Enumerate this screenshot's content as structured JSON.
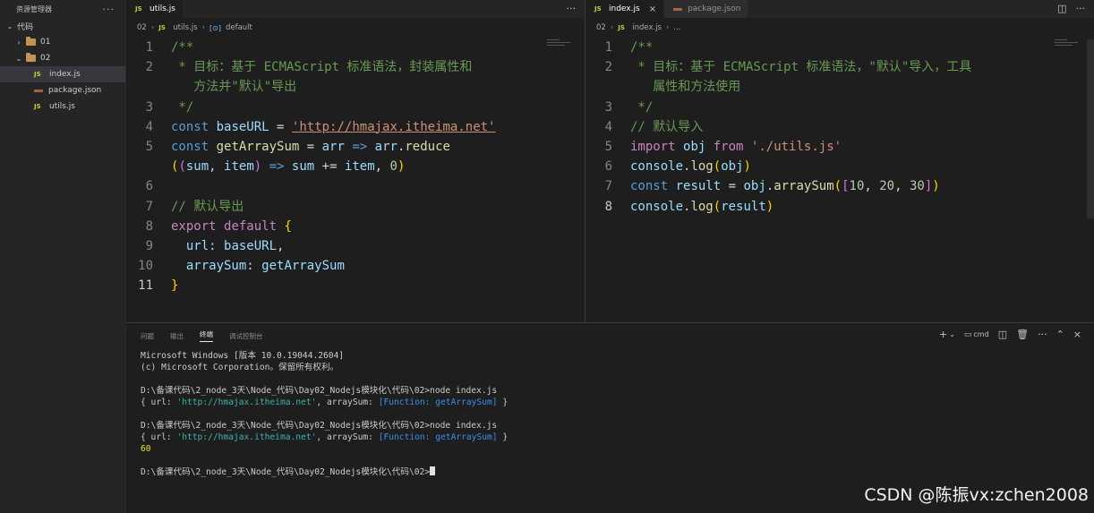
{
  "explorer": {
    "title": "资源管理器",
    "more": "···",
    "root": "代码",
    "items": [
      {
        "label": "01"
      },
      {
        "label": "02"
      },
      {
        "label": "index.js"
      },
      {
        "label": "package.json"
      },
      {
        "label": "utils.js"
      }
    ]
  },
  "editor_left": {
    "tab_label": "utils.js",
    "tab_badge": "JS",
    "more": "···",
    "breadcrumb": {
      "folder": "02",
      "file": "utils.js",
      "symbol": "default",
      "symbol_icon": "[⊙]"
    },
    "line_numbers": [
      "1",
      "2",
      "",
      "3",
      "4",
      "5",
      "",
      "6",
      "7",
      "8",
      "9",
      "10",
      "11"
    ]
  },
  "editor_right": {
    "tabs": [
      {
        "label": "index.js",
        "badge": "JS",
        "close": "×"
      },
      {
        "label": "package.json"
      }
    ],
    "breadcrumb": {
      "folder": "02",
      "file": "index.js",
      "rest": "..."
    },
    "line_numbers": [
      "1",
      "2",
      "",
      "3",
      "4",
      "5",
      "6",
      "7",
      "8"
    ]
  },
  "panel": {
    "tabs": [
      "问题",
      "输出",
      "终端",
      "调试控制台"
    ],
    "active_tab": "终端",
    "actions": {
      "add": "+",
      "chevron": "⌄",
      "shell": "cmd",
      "more": "···",
      "up": "⌃",
      "close": "×"
    },
    "terminal": {
      "line1": "Microsoft Windows [版本 10.0.19044.2604]",
      "line2": "(c) Microsoft Corporation。保留所有权利。",
      "prompt_cmd": "D:\\备课代码\\2_node_3天\\Node_代码\\Day02_Nodejs模块化\\代码\\02>node index.js",
      "out_prefix": "{ url: ",
      "out_url": "'http://hmajax.itheima.net'",
      "out_mid": ", arraySum: ",
      "out_fn": "[Function: getArraySum]",
      "out_suffix": " }",
      "result": "60",
      "prompt_final": "D:\\备课代码\\2_node_3天\\Node_代码\\Day02_Nodejs模块化\\代码\\02>"
    }
  },
  "watermark": "CSDN @陈振vx:zchen2008"
}
